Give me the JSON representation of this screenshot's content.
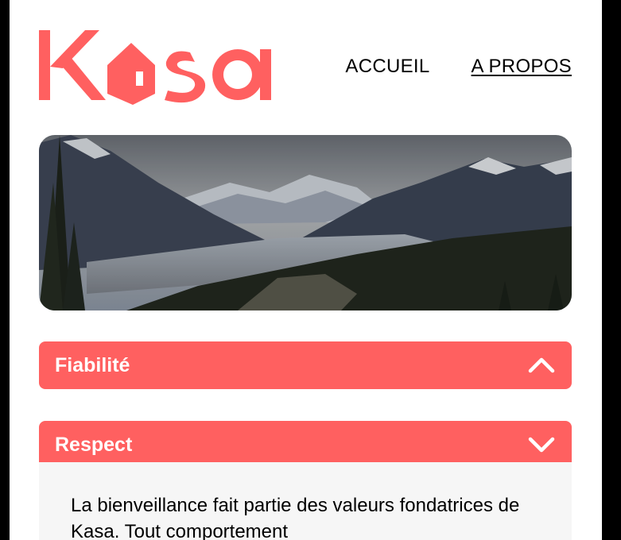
{
  "app": {
    "brand": "Kasa",
    "accent_color": "#ff6060"
  },
  "nav": {
    "items": [
      {
        "label": "ACCUEIL",
        "active": false
      },
      {
        "label": "A PROPOS",
        "active": true
      }
    ]
  },
  "banner": {
    "icon": "mountain-landscape-image"
  },
  "sections": [
    {
      "title": "Fiabilité",
      "expanded": false,
      "icon": "chevron-up-icon"
    },
    {
      "title": "Respect",
      "expanded": true,
      "icon": "chevron-down-icon",
      "content": "La bienveillance fait partie des valeurs fondatrices de Kasa. Tout comportement"
    }
  ]
}
